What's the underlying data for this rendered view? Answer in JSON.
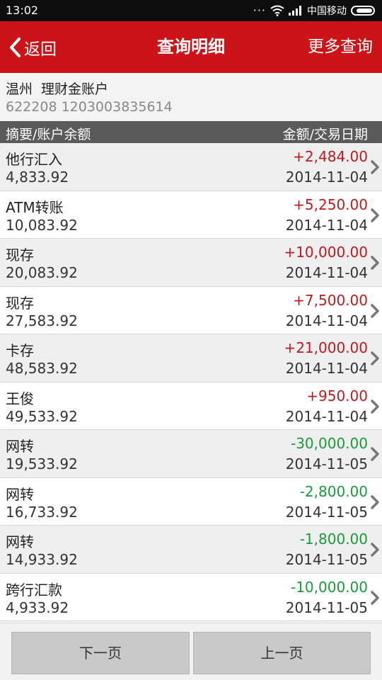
{
  "status_bar": {
    "time": "13:02",
    "carrier": "中国移动",
    "dots": "···"
  },
  "nav": {
    "back_label": "返回",
    "title": "查询明细",
    "more_label": "更多查询",
    "color": "#cc1418"
  },
  "account": {
    "city": "温州",
    "type": "理财金账户",
    "number": "622208 1203003835614"
  },
  "table_header": {
    "left": "摘要/账户余额",
    "right": "金额/交易日期"
  },
  "transactions": [
    {
      "desc": "他行汇入",
      "balance": "4,833.92",
      "amount": "+2,484.00",
      "date": "2014-11-04",
      "sign": "pos"
    },
    {
      "desc": "ATM转账",
      "balance": "10,083.92",
      "amount": "+5,250.00",
      "date": "2014-11-04",
      "sign": "pos"
    },
    {
      "desc": "现存",
      "balance": "20,083.92",
      "amount": "+10,000.00",
      "date": "2014-11-04",
      "sign": "pos"
    },
    {
      "desc": "现存",
      "balance": "27,583.92",
      "amount": "+7,500.00",
      "date": "2014-11-04",
      "sign": "pos"
    },
    {
      "desc": "卡存",
      "balance": "48,583.92",
      "amount": "+21,000.00",
      "date": "2014-11-04",
      "sign": "pos"
    },
    {
      "desc": "王俊",
      "balance": "49,533.92",
      "amount": "+950.00",
      "date": "2014-11-04",
      "sign": "pos"
    },
    {
      "desc": "网转",
      "balance": "19,533.92",
      "amount": "-30,000.00",
      "date": "2014-11-05",
      "sign": "neg"
    },
    {
      "desc": "网转",
      "balance": "16,733.92",
      "amount": "-2,800.00",
      "date": "2014-11-05",
      "sign": "neg"
    },
    {
      "desc": "网转",
      "balance": "14,933.92",
      "amount": "-1,800.00",
      "date": "2014-11-05",
      "sign": "neg"
    },
    {
      "desc": "跨行汇款",
      "balance": "4,933.92",
      "amount": "-10,000.00",
      "date": "2014-11-05",
      "sign": "neg"
    }
  ],
  "footer": {
    "next_label": "下一页",
    "prev_label": "上一页"
  },
  "colors": {
    "positive": "#c01a1e",
    "negative": "#1a9a3a"
  },
  "icons": {
    "back": "chevron-left-icon",
    "row": "chevron-right-icon",
    "wifi": "wifi-icon",
    "signal": "signal-icon",
    "battery": "battery-icon"
  }
}
